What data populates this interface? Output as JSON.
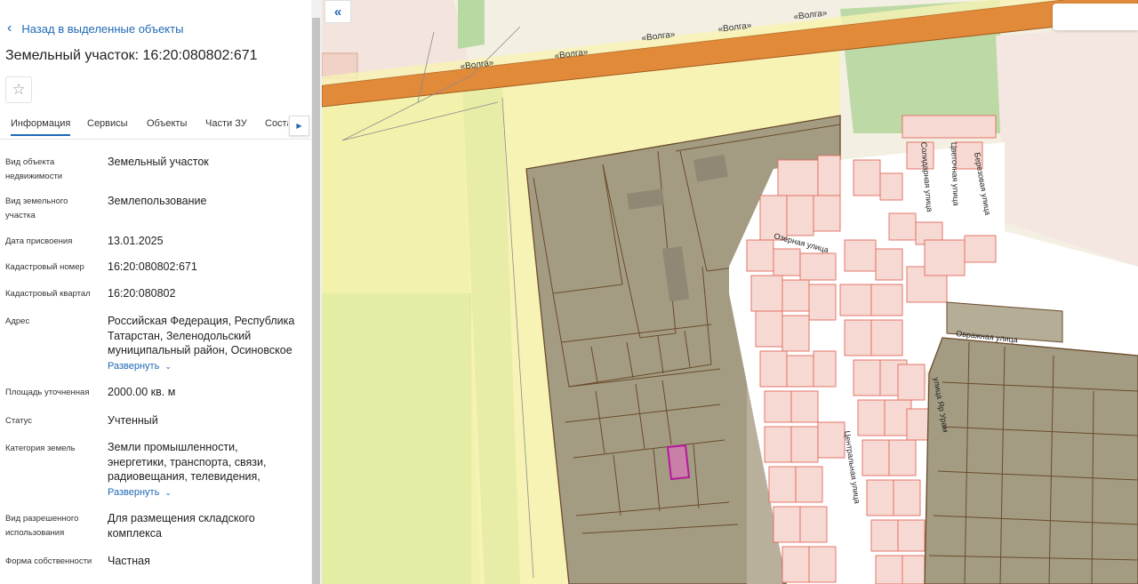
{
  "nav": {
    "back_label": "Назад в выделенные объекты"
  },
  "object": {
    "title": "Земельный участок: 16:20:080802:671"
  },
  "tabs": [
    "Информация",
    "Сервисы",
    "Объекты",
    "Части ЗУ",
    "Соста"
  ],
  "fields": [
    {
      "label": "Вид объекта недвижимости",
      "value": "Земельный участок"
    },
    {
      "label": "Вид земельного участка",
      "value": "Землепользование"
    },
    {
      "label": "Дата присвоения",
      "value": "13.01.2025"
    },
    {
      "label": "Кадастровый номер",
      "value": "16:20:080802:671"
    },
    {
      "label": "Кадастровый квартал",
      "value": "16:20:080802"
    },
    {
      "label": "Адрес",
      "value": "Российская Федерация, Республика Татарстан, Зеленодольский муниципальный район, Осиновское"
    },
    {
      "label": "Площадь уточненная",
      "value": "2000.00 кв. м"
    },
    {
      "label": "Статус",
      "value": "Учтенный"
    },
    {
      "label": "Категория земель",
      "value": "Земли промышленности, энергетики, транспорта, связи, радиовещания, телевидения,"
    },
    {
      "label": "Вид разрешенного использования",
      "value": "Для размещения складского комплекса"
    },
    {
      "label": "Форма собственности",
      "value": "Частная"
    }
  ],
  "expand_label": "Развернуть",
  "map": {
    "road_label": "«Волга»",
    "streets": {
      "ozernaya": "Озерная улица",
      "ovrazhnaya": "Овражная улица",
      "tsentralnaya": "Центральная улица",
      "solidarnaya": "Солидарная улица",
      "tsvetochnaya": "Цветочная улица",
      "berezovaya": "Березовая улица",
      "yar": "улица Яр Урам"
    },
    "colors": {
      "parcel_fill": "#a39c83",
      "parcel_stroke": "#6b4a2b",
      "building_fill": "#f7d9d3",
      "building_stroke": "#e06a5e",
      "road": "#e08a3a",
      "selected": "#b4189a"
    }
  },
  "icons": {
    "back": "chevron-left-icon",
    "star": "star-icon",
    "tab_next": "chevron-right-icon",
    "collapse": "double-chevron-left-icon"
  }
}
